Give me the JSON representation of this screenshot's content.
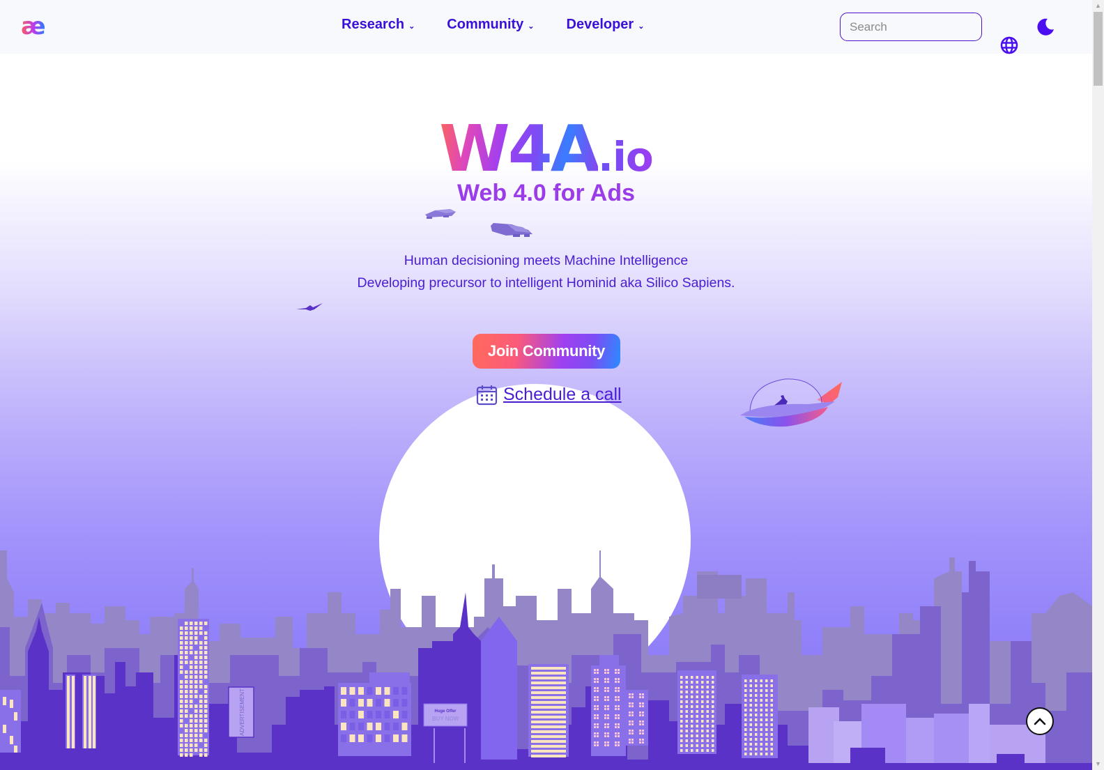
{
  "header": {
    "logo_text": "æ",
    "nav": [
      {
        "label": "Research",
        "icon": "chevron-down-icon"
      },
      {
        "label": "Community",
        "icon": "chevron-down-icon"
      },
      {
        "label": "Developer",
        "icon": "chevron-down-icon"
      }
    ],
    "search": {
      "value": "",
      "placeholder": "Search"
    },
    "theme_toggle_icon": "moon-icon",
    "language_icon": "globe-icon"
  },
  "hero": {
    "brand_main": "W4A",
    "brand_suffix": ".io",
    "tagline": "Web 4.0 for Ads",
    "description_lines": [
      "Human decisioning meets Machine Intelligence",
      "Developing precursor to intelligent Hominid aka Silico Sapiens."
    ],
    "cta_label": "Join Community",
    "schedule_label": "Schedule a call",
    "schedule_icon": "calendar-icon"
  },
  "illustration": {
    "billboard_small_title": "Huge Offer",
    "billboard_small_cta": "BUY NOW",
    "vertical_sign": "ADVERTISEMENT"
  },
  "scroll_top_icon": "chevron-up-icon",
  "colors": {
    "brand_purple": "#3a10d8",
    "accent_violet": "#9a3ce8",
    "gradient_start": "#ff6b5b",
    "gradient_end": "#2a8cff",
    "city_dark": "#5a32c8",
    "city_mid": "#7c64cc",
    "city_light": "#9586c8",
    "window_lit": "#fbe4c0"
  }
}
